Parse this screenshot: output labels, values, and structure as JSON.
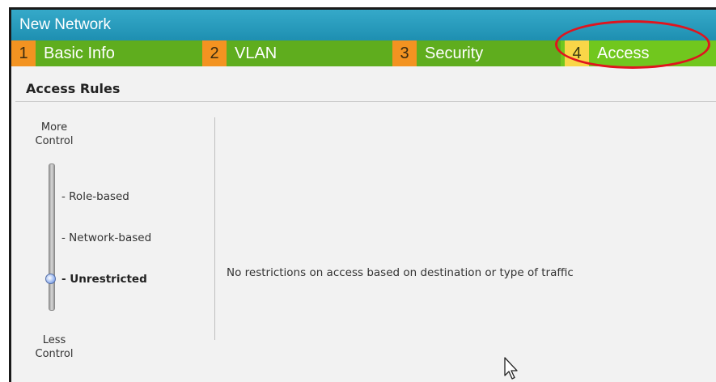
{
  "window": {
    "title": "New Network"
  },
  "tabs": [
    {
      "num": "1",
      "label": "Basic Info"
    },
    {
      "num": "2",
      "label": "VLAN"
    },
    {
      "num": "3",
      "label": "Security"
    },
    {
      "num": "4",
      "label": "Access",
      "active": true
    }
  ],
  "access_rules": {
    "title": "Access Rules",
    "slider": {
      "top_label": "More Control",
      "bottom_label": "Less Control",
      "options": [
        "- Role-based",
        "- Network-based",
        "- Unrestricted"
      ],
      "selected": "- Unrestricted"
    },
    "description": "No restrictions on access based on destination or type of traffic"
  },
  "colors": {
    "titlebar": "#2aa0c2",
    "tab_bar": "#5fad1e",
    "tab_number": "#f39321",
    "active_tab_number": "#f9d648",
    "highlight": "#e0141e"
  },
  "icons": [
    "mouse-cursor-icon",
    "slider-knob-icon"
  ]
}
